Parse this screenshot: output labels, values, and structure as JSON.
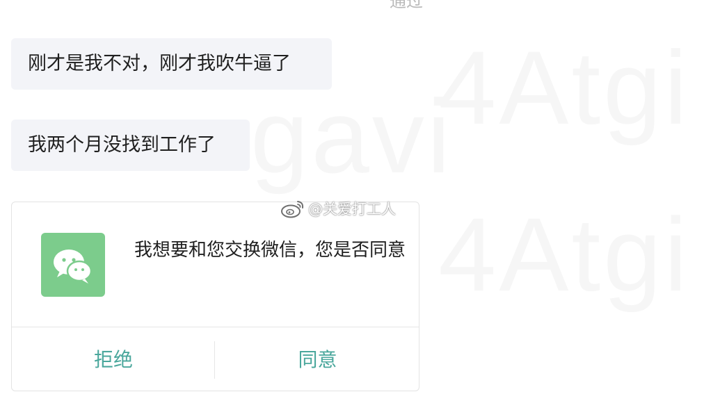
{
  "top_status": {
    "text": "通过"
  },
  "messages": [
    {
      "text": "刚才是我不对，刚才我吹牛逼了"
    },
    {
      "text": "我两个月没找到工作了"
    }
  ],
  "exchange_card": {
    "icon": "wechat-icon",
    "message": "我想要和您交换微信，您是否同意",
    "reject_label": "拒绝",
    "accept_label": "同意",
    "accent_color": "#4aa79c",
    "icon_bg_color": "#7ccc8c"
  },
  "watermark": {
    "icon": "weibo-icon",
    "text": "@关爱打工人"
  }
}
